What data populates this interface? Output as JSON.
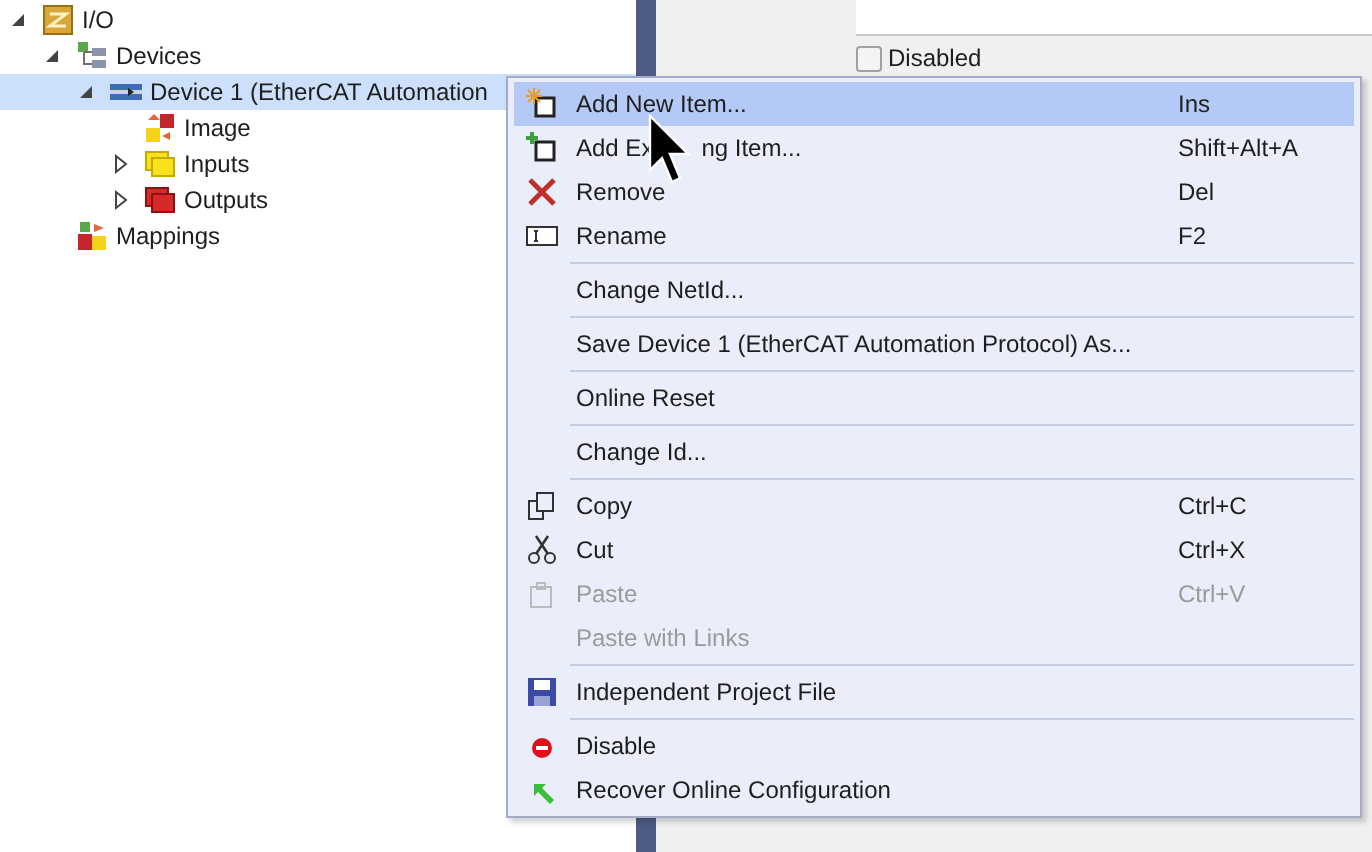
{
  "tree": [
    {
      "label": "I/O",
      "expanded": true,
      "selected": false,
      "children": [
        {
          "label": "Devices",
          "expanded": true,
          "selected": false,
          "children": [
            {
              "label": "Device 1 (EtherCAT Automation",
              "expanded": true,
              "selected": true,
              "children": [
                {
                  "label": "Image",
                  "selected": false
                },
                {
                  "label": "Inputs",
                  "expanded": false,
                  "selected": false
                },
                {
                  "label": "Outputs",
                  "expanded": false,
                  "selected": false
                }
              ]
            }
          ]
        },
        {
          "label": "Mappings",
          "selected": false
        }
      ]
    }
  ],
  "properties": {
    "checkbox": {
      "label": "Disabled",
      "checked": false
    }
  },
  "context_menu": [
    {
      "kind": "item",
      "label": "Add New Item...",
      "shortcut": "Ins",
      "selected": true,
      "disabled": false
    },
    {
      "kind": "item",
      "label": "Add Ex",
      "label_after_cursor": "ng Item...",
      "shortcut": "Shift+Alt+A",
      "selected": false,
      "disabled": false
    },
    {
      "kind": "item",
      "label": "Remove",
      "shortcut": "Del",
      "selected": false,
      "disabled": false
    },
    {
      "kind": "item",
      "label": "Rename",
      "shortcut": "F2",
      "selected": false,
      "disabled": false
    },
    {
      "kind": "separator"
    },
    {
      "kind": "item",
      "label": "Change NetId...",
      "selected": false,
      "disabled": false
    },
    {
      "kind": "separator"
    },
    {
      "kind": "item",
      "label": "Save Device 1 (EtherCAT Automation Protocol) As...",
      "selected": false,
      "disabled": false
    },
    {
      "kind": "separator"
    },
    {
      "kind": "item",
      "label": "Online Reset",
      "selected": false,
      "disabled": false
    },
    {
      "kind": "separator"
    },
    {
      "kind": "item",
      "label": "Change Id...",
      "selected": false,
      "disabled": false
    },
    {
      "kind": "separator"
    },
    {
      "kind": "item",
      "label": "Copy",
      "shortcut": "Ctrl+C",
      "selected": false,
      "disabled": false
    },
    {
      "kind": "item",
      "label": "Cut",
      "shortcut": "Ctrl+X",
      "selected": false,
      "disabled": false
    },
    {
      "kind": "item",
      "label": "Paste",
      "shortcut": "Ctrl+V",
      "selected": false,
      "disabled": true
    },
    {
      "kind": "item",
      "label": "Paste with Links",
      "selected": false,
      "disabled": true
    },
    {
      "kind": "separator"
    },
    {
      "kind": "item",
      "label": "Independent Project File",
      "selected": false,
      "disabled": false
    },
    {
      "kind": "separator"
    },
    {
      "kind": "item",
      "label": "Disable",
      "selected": false,
      "disabled": false
    },
    {
      "kind": "item",
      "label": "Recover Online Configuration",
      "selected": false,
      "disabled": false
    }
  ]
}
